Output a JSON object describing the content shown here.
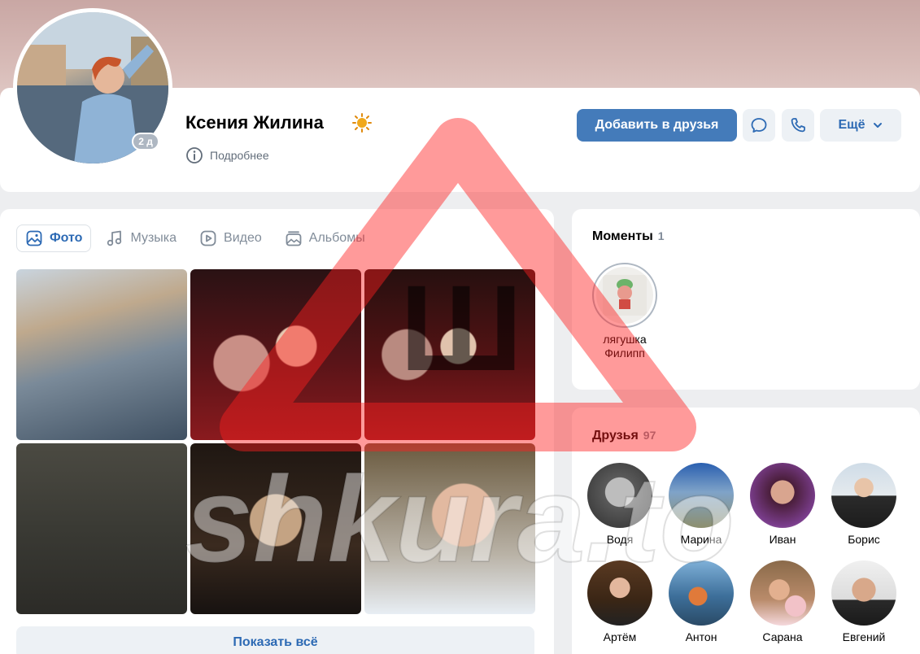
{
  "profile": {
    "name": "Ксения Жилина",
    "online_badge": "2 д",
    "details_label": "Подробнее"
  },
  "actions": {
    "add_friend_label": "Добавить в друзья",
    "more_label": "Ещё"
  },
  "tabs": [
    {
      "label": "Фото",
      "icon": "photo-icon",
      "active": true
    },
    {
      "label": "Музыка",
      "icon": "music-icon",
      "active": false
    },
    {
      "label": "Видео",
      "icon": "video-icon",
      "active": false
    },
    {
      "label": "Альбомы",
      "icon": "albums-icon",
      "active": false
    }
  ],
  "photos": {
    "show_all_label": "Показать всё"
  },
  "moments": {
    "title": "Моменты",
    "count": "1",
    "items": [
      {
        "caption": "лягушка Филипп"
      }
    ]
  },
  "friends": {
    "title": "Друзья",
    "count": "97",
    "items": [
      {
        "name": "Водя"
      },
      {
        "name": "Марина"
      },
      {
        "name": "Иван"
      },
      {
        "name": "Борис"
      },
      {
        "name": "Артём"
      },
      {
        "name": "Антон"
      },
      {
        "name": "Сарана"
      },
      {
        "name": "Евгений"
      }
    ]
  },
  "watermark": {
    "text": "shkura.to",
    "glyph": "Ш"
  },
  "colors": {
    "accent": "#447bba",
    "link": "#2d6ab4",
    "watermark_red": "#ff2020"
  }
}
